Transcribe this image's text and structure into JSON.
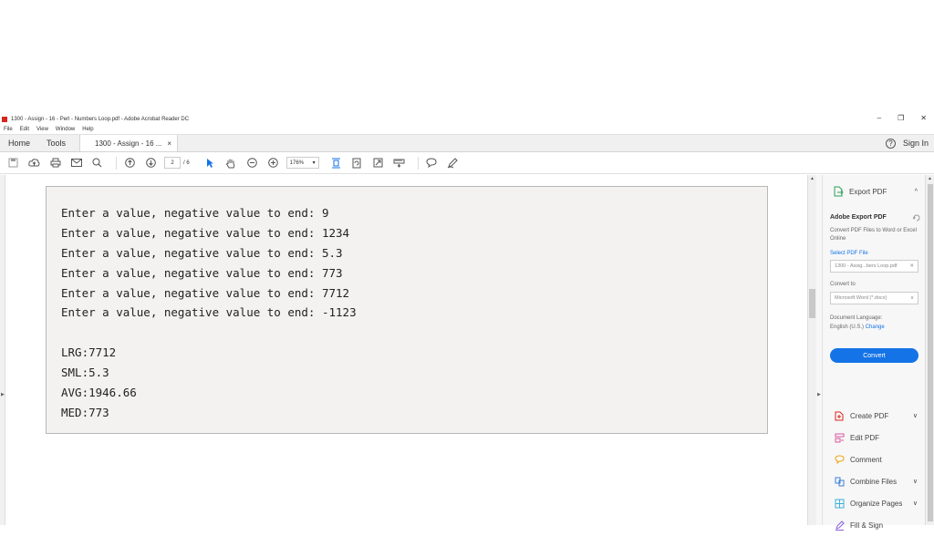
{
  "window": {
    "title": "1300 - Assign - 16 - Perl - Numbers Loop.pdf - Adobe Acrobat Reader DC",
    "controls": {
      "minimize": "–",
      "restore": "❐",
      "close": "✕"
    }
  },
  "menu": {
    "items": [
      "File",
      "Edit",
      "View",
      "Window",
      "Help"
    ]
  },
  "tabs": {
    "home": "Home",
    "tools": "Tools",
    "doc_tab": "1300 - Assign - 16 ...",
    "doc_close": "×",
    "help": "?",
    "sign_in": "Sign In"
  },
  "toolbar": {
    "page_current": "2",
    "page_total": "/ 6",
    "zoom": "176%",
    "zoom_arrow": "▾"
  },
  "document": {
    "lines": [
      "Enter a value, negative value to end: 9",
      "Enter a value, negative value to end: 1234",
      "Enter a value, negative value to end: 5.3",
      "Enter a value, negative value to end: 773",
      "Enter a value, negative value to end: 7712",
      "Enter a value, negative value to end: -1123",
      "",
      "LRG:7712",
      "SML:5.3",
      "AVG:1946.66",
      "MED:773"
    ]
  },
  "right_pane": {
    "header": "Export PDF",
    "header_chevron": "^",
    "panel_title": "Adobe Export PDF",
    "description": "Convert PDF Files to Word or Excel Online",
    "select_file_label": "Select PDF File",
    "selected_file": "1300 - Assig...bers Loop.pdf",
    "file_clear": "✕",
    "convert_to_label": "Convert to",
    "convert_to_value": "Microsoft Word (*.docx)",
    "convert_to_arrow": "∨",
    "doc_language_label": "Document Language:",
    "doc_language_value": "English (U.S.)",
    "change_link": "Change",
    "convert_button": "Convert",
    "tools": [
      {
        "label": "Create PDF",
        "chevron": "∨"
      },
      {
        "label": "Edit PDF",
        "chevron": ""
      },
      {
        "label": "Comment",
        "chevron": ""
      },
      {
        "label": "Combine Files",
        "chevron": "∨"
      },
      {
        "label": "Organize Pages",
        "chevron": "∨"
      },
      {
        "label": "Fill & Sign",
        "chevron": ""
      }
    ]
  },
  "colors": {
    "accent": "#1473e6",
    "page_bg": "#f4f2f0",
    "pdf_red": "#d9251c"
  }
}
